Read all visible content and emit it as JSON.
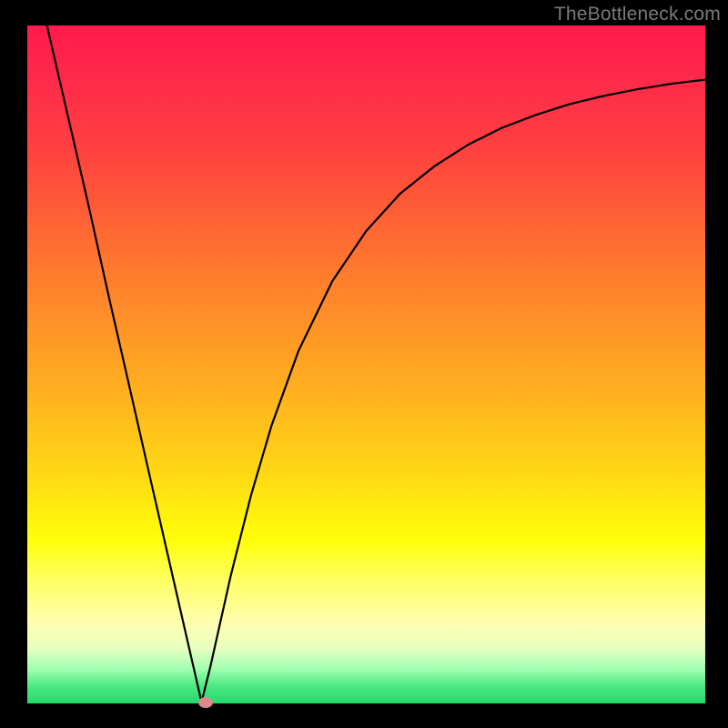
{
  "watermark": "TheBottleneck.com",
  "chart_data": {
    "type": "line",
    "title": "",
    "xlabel": "",
    "ylabel": "",
    "xlim": [
      0,
      1
    ],
    "ylim": [
      0,
      1
    ],
    "series": [
      {
        "name": "curve",
        "x": [
          0.029,
          0.06,
          0.09,
          0.12,
          0.15,
          0.18,
          0.21,
          0.24,
          0.257,
          0.27,
          0.3,
          0.33,
          0.36,
          0.4,
          0.45,
          0.5,
          0.55,
          0.6,
          0.65,
          0.7,
          0.75,
          0.8,
          0.85,
          0.9,
          0.95,
          1.0
        ],
        "y": [
          1.0,
          0.866,
          0.736,
          0.601,
          0.47,
          0.338,
          0.207,
          0.076,
          0.002,
          0.054,
          0.188,
          0.307,
          0.409,
          0.52,
          0.623,
          0.697,
          0.752,
          0.792,
          0.824,
          0.849,
          0.868,
          0.884,
          0.896,
          0.906,
          0.914,
          0.92
        ]
      }
    ],
    "marker": {
      "x": 0.263,
      "y": 0.002
    },
    "background_gradient": {
      "top": "#ff1a4d",
      "mid": "#ffd800",
      "bottom": "#23d96a"
    }
  }
}
